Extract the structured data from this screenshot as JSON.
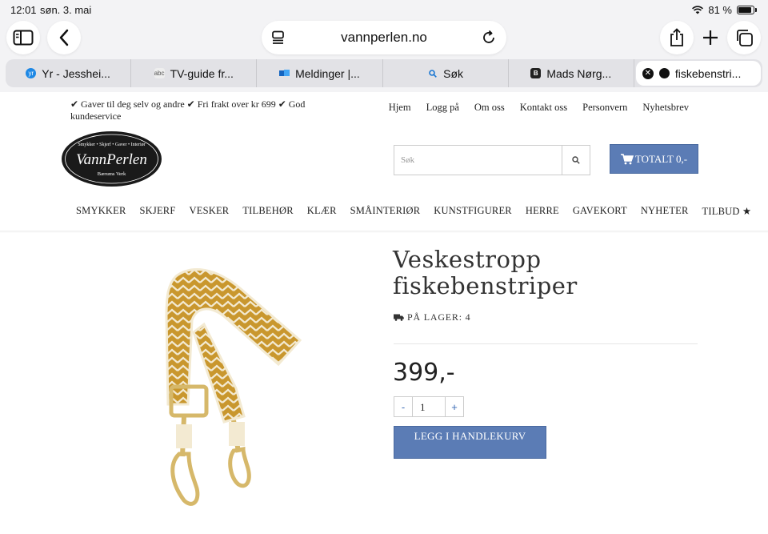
{
  "status": {
    "time": "12:01",
    "date": "søn. 3. mai",
    "battery": "81 %"
  },
  "browser": {
    "url": "vannperlen.no",
    "tabs": [
      {
        "label": "Yr - Jesshei...",
        "favicon_text": "yr",
        "favicon_color": "#1e88e5"
      },
      {
        "label": "TV-guide fr...",
        "favicon_text": "abc",
        "favicon_color": "#9e9e9e"
      },
      {
        "label": "Meldinger |...",
        "favicon_text": "",
        "favicon_color": "#1565c0"
      },
      {
        "label": "Søk",
        "favicon_text": "",
        "favicon_color": "#1976d2"
      },
      {
        "label": "Mads Nørg...",
        "favicon_text": "B",
        "favicon_color": "#212121"
      },
      {
        "label": "fiskebenstri...",
        "favicon_text": "",
        "favicon_color": "#111111",
        "active": true
      }
    ]
  },
  "site": {
    "info_text": "✔ Gaver til deg selv og andre   ✔ Fri frakt over kr 699   ✔ God kundeservice",
    "top_links": [
      "Hjem",
      "Logg på",
      "Om oss",
      "Kontakt oss",
      "Personvern",
      "Nyhetsbrev"
    ],
    "logo": {
      "name": "VannPerlen",
      "tagline": "Smykker • Skjerf • Gaver • Interiør",
      "location": "Bærums Verk"
    },
    "search_placeholder": "Søk",
    "cart_label": "TOTALT 0,-",
    "nav": [
      "SMYKKER",
      "SKJERF",
      "VESKER",
      "TILBEHØR",
      "KLÆR",
      "SMÅINTERIØR",
      "KUNSTFIGURER",
      "HERRE",
      "GAVEKORT",
      "NYHETER",
      "TILBUD ★"
    ]
  },
  "product": {
    "title": "Veskestropp fiskebenstriper",
    "stock": "PÅ LAGER: 4",
    "price": "399,-",
    "quantity": "1",
    "minus": "-",
    "plus": "+",
    "add_to_cart": "LEGG I HANDLEKURV"
  },
  "colors": {
    "accent": "#5b7cb5",
    "strap_mustard": "#c9972e",
    "strap_cream": "#f3ead2",
    "hardware_gold": "#d6b86a"
  }
}
